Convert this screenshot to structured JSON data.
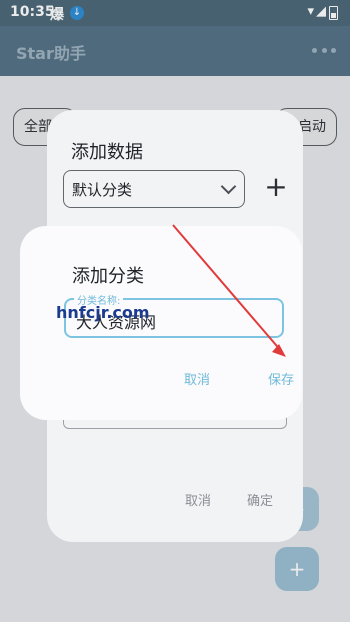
{
  "status_bar": {
    "time": "10:35",
    "carrier": "爆",
    "download_icon": "download-icon",
    "wifi_icon": "wifi-icon",
    "signal_icon": "signal-icon",
    "battery_icon": "battery-icon"
  },
  "app_bar": {
    "title": "Star助手",
    "more_icon": "more-icon"
  },
  "page": {
    "chip_left": "全部",
    "chip_right": "启动",
    "fab_icon": "plus-icon"
  },
  "back_dialog": {
    "title": "添加数据",
    "category_value": "默认分类",
    "add_icon": "plus-icon",
    "cancel_label": "取消",
    "confirm_label": "确定"
  },
  "front_dialog": {
    "title": "添加分类",
    "field_label": "分类名称:",
    "field_value": "大人资源网",
    "cancel_label": "取消",
    "save_label": "保存"
  },
  "overlay": {
    "watermark": "hnfcjr.com",
    "arrow_color": "#e13a3a"
  }
}
